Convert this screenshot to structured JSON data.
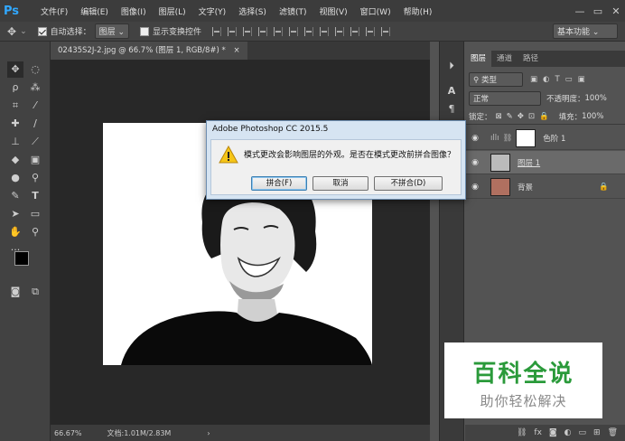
{
  "app": {
    "logo": "Ps"
  },
  "menu": [
    "文件(F)",
    "编辑(E)",
    "图像(I)",
    "图层(L)",
    "文字(Y)",
    "选择(S)",
    "滤镜(T)",
    "视图(V)",
    "窗口(W)",
    "帮助(H)"
  ],
  "window_controls": {
    "minimize": "—",
    "restore": "▭",
    "close": "✕"
  },
  "options": {
    "auto_select_label": "自动选择：",
    "auto_select_value": "图层",
    "show_transform_label": "显示变换控件",
    "workspace": "基本功能"
  },
  "document": {
    "tab_label": "02435S2J-2.jpg @ 66.7% (图层 1, RGB/8#) *",
    "tab_close": "×"
  },
  "status": {
    "zoom": "66.67%",
    "doc_info": "文档:1.01M/2.83M",
    "arrow": "›"
  },
  "layers_panel": {
    "tabs": [
      "图层",
      "通道",
      "路径"
    ],
    "filter_label": "类型",
    "blend_mode": "正常",
    "opacity_label": "不透明度：",
    "opacity_value": "100%",
    "lock_label": "锁定：",
    "fill_label": "填充：",
    "fill_value": "100%",
    "layers": [
      {
        "name": "色阶 1",
        "type": "adjustment"
      },
      {
        "name": "图层 1",
        "type": "image",
        "active": true
      },
      {
        "name": "背景",
        "type": "background",
        "locked": true
      }
    ]
  },
  "dialog": {
    "title": "Adobe Photoshop CC 2015.5",
    "message": "模式更改会影响图层的外观。是否在模式更改前拼合图像？",
    "buttons": [
      "拼合(F)",
      "取消",
      "不拼合(D)"
    ]
  },
  "watermark": {
    "title": "百科全说",
    "subtitle": "助你轻松解决"
  },
  "colors": {
    "accent": "#31a8ff",
    "dialog_bg": "#d6e4f2",
    "watermark_green": "#2a9a3a"
  }
}
